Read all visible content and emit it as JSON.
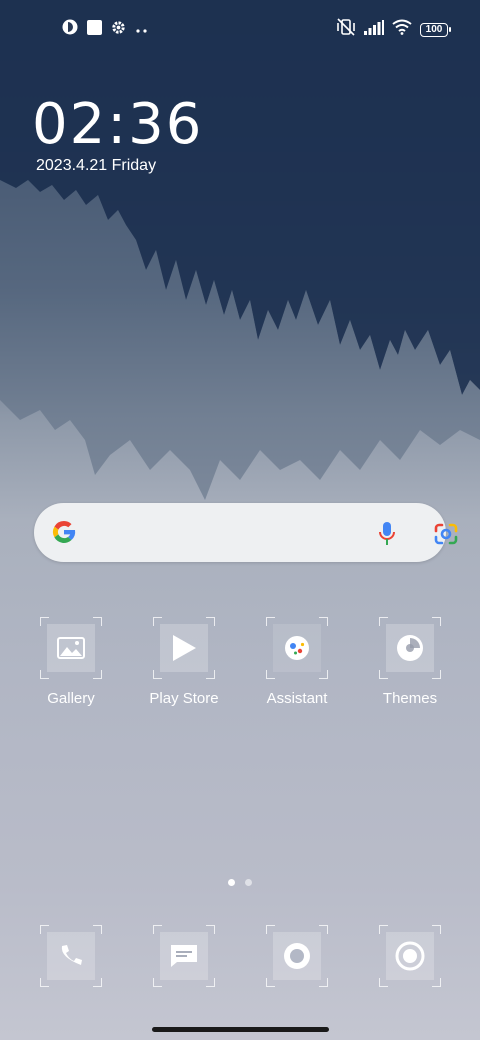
{
  "status_bar": {
    "battery_level": "100",
    "icons": [
      "notification-app-icon",
      "square-notification-icon",
      "settings-gear-icon",
      "more-dots-icon",
      "vibrate-off-icon",
      "signal-icon",
      "wifi-icon",
      "battery-icon"
    ]
  },
  "clock": {
    "time": "02:36",
    "date": "2023.4.21 Friday"
  },
  "search_bar": {
    "icons": [
      "google-g-icon",
      "microphone-icon",
      "google-lens-icon"
    ]
  },
  "apps": [
    {
      "label": "Gallery",
      "icon": "gallery-icon"
    },
    {
      "label": "Play Store",
      "icon": "play-store-icon"
    },
    {
      "label": "Assistant",
      "icon": "assistant-icon"
    },
    {
      "label": "Themes",
      "icon": "themes-icon"
    }
  ],
  "dock": [
    {
      "icon": "phone-icon"
    },
    {
      "icon": "messages-icon"
    },
    {
      "icon": "browser-icon"
    },
    {
      "icon": "camera-icon"
    }
  ],
  "page_indicator": {
    "current": 1,
    "total": 2
  }
}
